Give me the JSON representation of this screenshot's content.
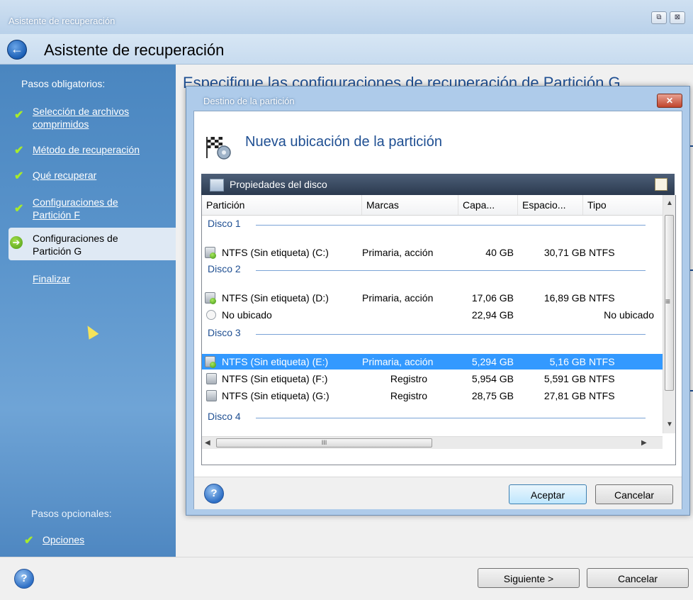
{
  "window": {
    "title": "Asistente de recuperación",
    "restore_glyph": "⧉",
    "close_glyph": "⊠"
  },
  "header": {
    "back_glyph": "←",
    "title": "Asistente de recuperación"
  },
  "background_heading": "Especifique las configuraciones de recuperación de Partición G",
  "sidebar": {
    "required_label": "Pasos obligatorios:",
    "check_glyph": "✔",
    "steps": [
      {
        "label_line1": "Selección de archivos",
        "label_line2": "comprimidos",
        "state": "done"
      },
      {
        "label_line1": "Método de recuperación",
        "label_line2": "",
        "state": "done"
      },
      {
        "label_line1": "Qué recuperar",
        "label_line2": "",
        "state": "done"
      },
      {
        "label_line1": "Configuraciones de",
        "label_line2": "Partición F",
        "state": "done"
      },
      {
        "label_line1": "Configuraciones de",
        "label_line2": "Partición G",
        "state": "current"
      },
      {
        "label_line1": "Finalizar",
        "label_line2": "",
        "state": "pending"
      }
    ],
    "active_arrow_glyph": "➔",
    "optional_label": "Pasos opcionales:",
    "optional_items": [
      {
        "label": "Opciones",
        "state": "done"
      }
    ]
  },
  "footer": {
    "help_glyph": "?",
    "next_label": "Siguiente >",
    "cancel_label": "Cancelar"
  },
  "dialog": {
    "title": "Destino de la partición",
    "close_glyph": "✕",
    "heading": "Nueva ubicación de la partición",
    "panel_title": "Propiedades del disco",
    "columns": [
      "Partición",
      "Marcas",
      "Capa...",
      "Espacio...",
      "Tipo"
    ],
    "groups": [
      {
        "name": "Disco 1",
        "rows": [
          {
            "partition": "NTFS (Sin etiqueta) (C:)",
            "flags": "Primaria, acción",
            "capacity": "40 GB",
            "free": "30,71 GB",
            "type": "NTFS",
            "icon": "disk-boot",
            "selected": false
          }
        ]
      },
      {
        "name": "Disco 2",
        "rows": [
          {
            "partition": "NTFS (Sin etiqueta) (D:)",
            "flags": "Primaria, acción",
            "capacity": "17,06 GB",
            "free": "16,89 GB",
            "type": "NTFS",
            "icon": "disk-boot",
            "selected": false
          },
          {
            "partition": "No ubicado",
            "flags": "",
            "capacity": "22,94 GB",
            "free": "",
            "type": "No ubicado",
            "icon": "unallocated",
            "selected": false
          }
        ]
      },
      {
        "name": "Disco 3",
        "rows": [
          {
            "partition": "NTFS (Sin etiqueta) (E:)",
            "flags": "Primaria, acción",
            "capacity": "5,294 GB",
            "free": "5,16 GB",
            "type": "NTFS",
            "icon": "disk-boot",
            "selected": true
          },
          {
            "partition": "NTFS (Sin etiqueta) (F:)",
            "flags": "Registro",
            "capacity": "5,954 GB",
            "free": "5,591 GB",
            "type": "NTFS",
            "icon": "disk",
            "selected": false
          },
          {
            "partition": "NTFS (Sin etiqueta) (G:)",
            "flags": "Registro",
            "capacity": "28,75 GB",
            "free": "27,81 GB",
            "type": "NTFS",
            "icon": "disk",
            "selected": false
          }
        ]
      },
      {
        "name": "Disco 4",
        "rows": []
      }
    ],
    "hscroll_grip": "III",
    "scroll_arrows": {
      "up": "▲",
      "down": "▼",
      "left": "◀",
      "right": "▶"
    },
    "mid_grip": "≡",
    "help_glyph": "?",
    "ok_label": "Aceptar",
    "cancel_label": "Cancelar"
  }
}
